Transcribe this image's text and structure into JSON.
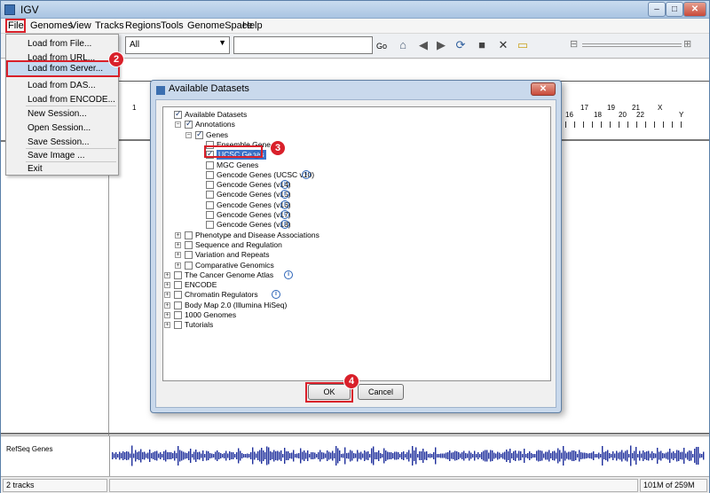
{
  "window": {
    "title": "IGV",
    "min": "–",
    "max": "□",
    "close": "✕"
  },
  "menubar": [
    "File",
    "Genomes",
    "View",
    "Tracks",
    "Regions",
    "Tools",
    "GenomeSpace",
    "Help"
  ],
  "toolbar": {
    "chromosome_value": "All",
    "go_label": "Go"
  },
  "ideogram_labels": [
    "1",
    "16",
    "17",
    "18",
    "19",
    "20",
    "21",
    "22",
    "X",
    "Y"
  ],
  "file_menu": [
    "Load from File...",
    "Load from URL...",
    "Load from Server...",
    "Load from DAS...",
    "Load from ENCODE...",
    "New Session...",
    "Open Session...",
    "Save Session...",
    "Save Image ...",
    "Exit"
  ],
  "badges": [
    "2",
    "3",
    "4"
  ],
  "dialog": {
    "title": "Available Datasets",
    "close": "✕",
    "tree": [
      {
        "label": "Available Datasets",
        "checked": true,
        "info": false
      },
      {
        "label": "Annotations",
        "checked": true,
        "info": false
      },
      {
        "label": "Genes",
        "checked": true,
        "info": false
      },
      {
        "label": "Ensemble Genes",
        "checked": false,
        "info": false
      },
      {
        "label": "UCSC Genes",
        "checked": true,
        "info": true
      },
      {
        "label": "MGC Genes",
        "checked": false,
        "info": false
      },
      {
        "label": "Gencode Genes (UCSC v10)",
        "checked": false,
        "info": true
      },
      {
        "label": "Gencode Genes (v14)",
        "checked": false,
        "info": true
      },
      {
        "label": "Gencode Genes (v15)",
        "checked": false,
        "info": true
      },
      {
        "label": "Gencode Genes (v16)",
        "checked": false,
        "info": true
      },
      {
        "label": "Gencode Genes (v17)",
        "checked": false,
        "info": true
      },
      {
        "label": "Gencode Genes (v18)",
        "checked": false,
        "info": true
      },
      {
        "label": "Phenotype and Disease Associations",
        "checked": false,
        "info": false
      },
      {
        "label": "Sequence and Regulation",
        "checked": false,
        "info": false
      },
      {
        "label": "Variation and Repeats",
        "checked": false,
        "info": false
      },
      {
        "label": "Comparative Genomics",
        "checked": false,
        "info": false
      },
      {
        "label": "The Cancer Genome Atlas",
        "checked": false,
        "info": true
      },
      {
        "label": "ENCODE",
        "checked": false,
        "info": false
      },
      {
        "label": "Chromatin Regulators",
        "checked": false,
        "info": true
      },
      {
        "label": "Body Map 2.0 (Illumina HiSeq)",
        "checked": false,
        "info": false
      },
      {
        "label": "1000 Genomes",
        "checked": false,
        "info": false
      },
      {
        "label": "Tutorials",
        "checked": false,
        "info": false
      }
    ],
    "ok_label": "OK",
    "cancel_label": "Cancel",
    "info_glyph": "i"
  },
  "track": {
    "name": "RefSeq Genes"
  },
  "status": {
    "tracks": "2 tracks",
    "memory": "101M of 259M"
  },
  "colors": {
    "highlight": "#d9202a",
    "selection": "#3d73c9",
    "track": "#1f2f9c"
  }
}
